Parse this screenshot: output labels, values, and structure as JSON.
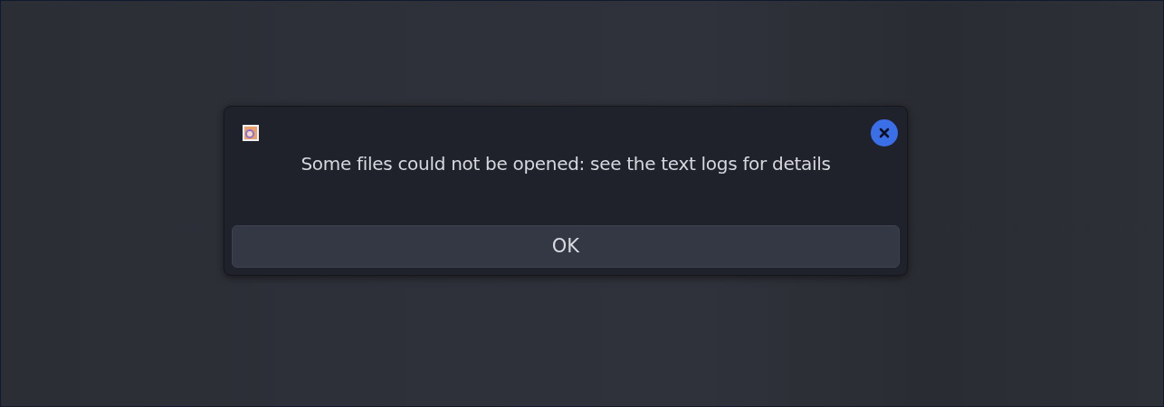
{
  "dialog": {
    "message": "Some files could not be opened: see the text logs for details",
    "buttons": [
      "OK"
    ]
  }
}
